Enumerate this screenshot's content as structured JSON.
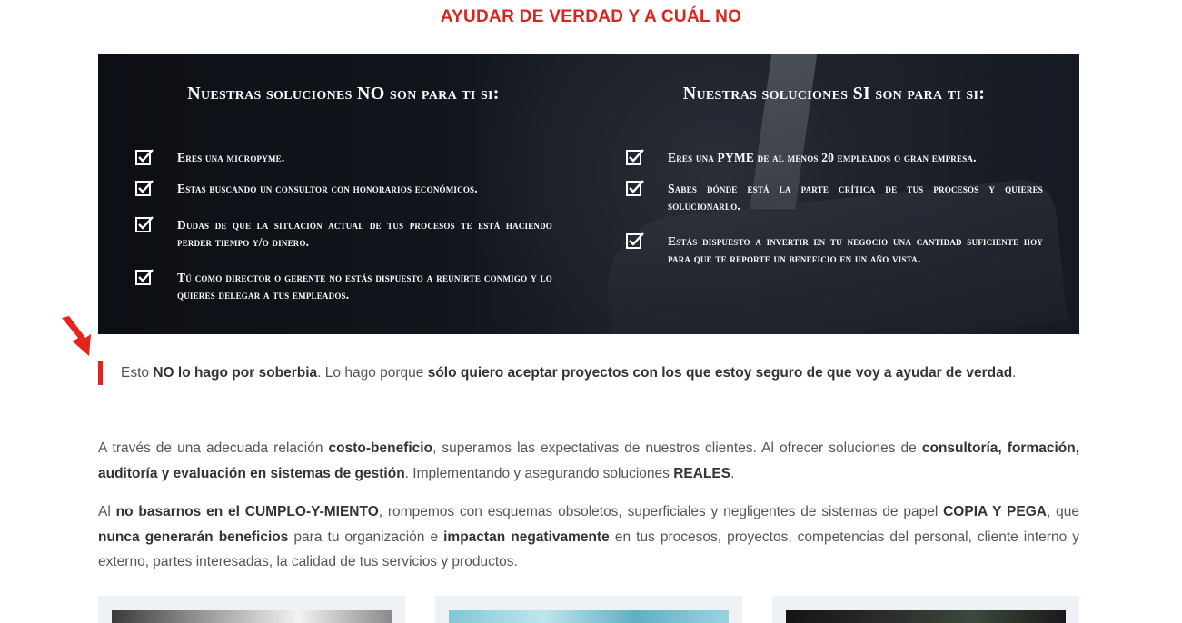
{
  "section": {
    "heading": "AYUDAR DE VERDAD Y A CUÁL NO"
  },
  "no_column": {
    "title": "Nuestras soluciones NO son para ti si:",
    "items": [
      "Eres una micropyme.",
      "Estas buscando un consultor con honorarios económicos.",
      "Dudas de que la situación actual de tus procesos te está haciendo perder tiempo y/o dinero.",
      "Tú como director o gerente no estás dispuesto a reunirte conmigo y lo quieres delegar a tus empleados."
    ]
  },
  "si_column": {
    "title": "Nuestras soluciones SI son para ti si:",
    "items": [
      "Eres una PYME de al menos 20 empleados o gran empresa.",
      "Sabes dónde está la parte crítica de tus procesos y quieres solucionarlo.",
      "Estás dispuesto a invertir en tu negocio una cantidad suficiente hoy para que te reporte un beneficio en un año vista."
    ]
  },
  "callout": {
    "t1": "Esto ",
    "b1": "NO lo hago por soberbia",
    "t2": ". Lo hago porque ",
    "b2": "sólo quiero aceptar proyectos con los que estoy seguro de que voy a ayudar de verdad",
    "t3": "."
  },
  "paragraph1": {
    "t1": "A través de una adecuada relación ",
    "b1": "costo-beneficio",
    "t2": ", superamos las expectativas de nuestros clientes. Al ofrecer soluciones de ",
    "b2": "consultoría, formación, auditoría y evaluación en sistemas de gestión",
    "t3": ". Implementando y asegurando soluciones ",
    "b3": "REALES",
    "t4": "."
  },
  "paragraph2": {
    "t1": "Al ",
    "b1": "no basarnos en el CUMPLO-Y-MIENTO",
    "t2": ", rompemos con esquemas obsoletos, superficiales y negligentes de sistemas de papel ",
    "b2": "COPIA Y PEGA",
    "t3": ", que ",
    "b3": "nunca generarán beneficios",
    "t4": " para tu organización e ",
    "b4": "impactan negativamente",
    "t5": " en tus procesos, proyectos, competencias del personal, cliente interno y externo, partes interesadas, la calidad de tus servicios y productos."
  },
  "colors": {
    "accent": "#d9261c",
    "hero_bg": "#171b24",
    "text": "#555555",
    "card_bg": "#eef1f6"
  },
  "icons": {
    "checklist": "checkbox-check-icon",
    "pointer": "red-arrow-icon"
  }
}
